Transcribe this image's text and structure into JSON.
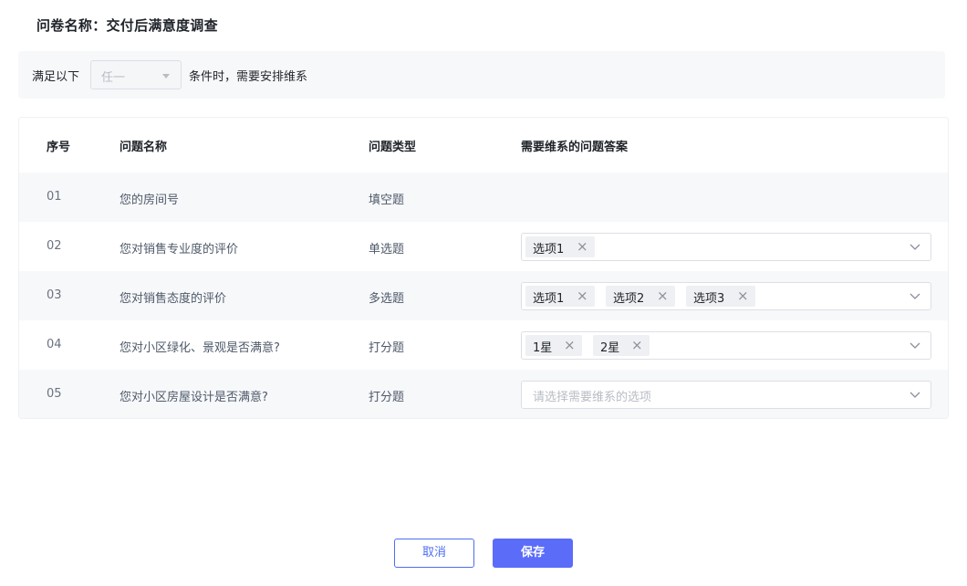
{
  "survey": {
    "title": "问卷名称：交付后满意度调查"
  },
  "condition": {
    "prefix": "满足以下",
    "select_value": "任一",
    "suffix": "条件时，需要安排维系"
  },
  "table": {
    "headers": [
      "序号",
      "问题名称",
      "问题类型",
      "需要维系的问题答案"
    ],
    "rows": [
      {
        "no": "01",
        "name": "您的房间号",
        "type": "填空题",
        "answers": [],
        "placeholder": ""
      },
      {
        "no": "02",
        "name": "您对销售专业度的评价",
        "type": "单选题",
        "answers": [
          "选项1"
        ],
        "placeholder": ""
      },
      {
        "no": "03",
        "name": "您对销售态度的评价",
        "type": "多选题",
        "answers": [
          "选项1",
          "选项2",
          "选项3"
        ],
        "placeholder": ""
      },
      {
        "no": "04",
        "name": "您对小区绿化、景观是否满意?",
        "type": "打分题",
        "answers": [
          "1星",
          "2星"
        ],
        "placeholder": ""
      },
      {
        "no": "05",
        "name": "您对小区房屋设计是否满意?",
        "type": "打分题",
        "answers": [],
        "placeholder": "请选择需要维系的选项"
      }
    ]
  },
  "footer": {
    "cancel_label": "取消",
    "save_label": "保存"
  },
  "colors": {
    "primary": "#5b6cf9",
    "row_shade": "#f7f8fa",
    "tag_bg": "#eef0f3"
  }
}
